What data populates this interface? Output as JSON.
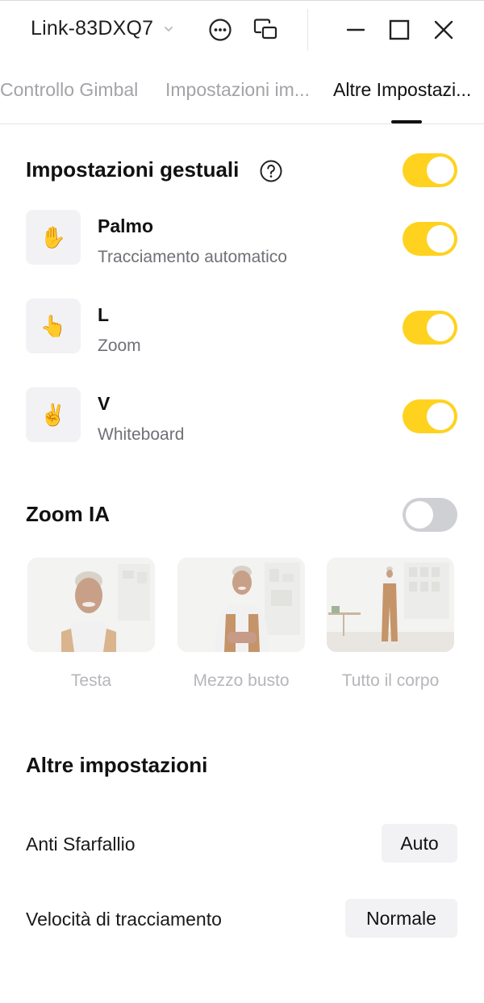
{
  "titlebar": {
    "device_name": "Link-83DXQ7",
    "icons": [
      "chevron-down-icon",
      "more-icon",
      "window-mode-icon",
      "minimize-icon",
      "maximize-icon",
      "close-icon"
    ]
  },
  "tabs": [
    {
      "label": "Controllo Gimbal",
      "active": false
    },
    {
      "label": "Impostazioni im...",
      "active": false
    },
    {
      "label": "Altre Impostazi...",
      "active": true
    }
  ],
  "gesture_settings": {
    "title": "Impostazioni gestuali",
    "enabled": true,
    "items": [
      {
        "icon": "✋",
        "icon_name": "palm-hand-icon",
        "title": "Palmo",
        "subtitle": "Tracciamento automatico",
        "enabled": true
      },
      {
        "icon": "👆",
        "icon_name": "pointing-finger-icon",
        "title": "L",
        "subtitle": "Zoom",
        "enabled": true
      },
      {
        "icon": "✌️",
        "icon_name": "victory-hand-icon",
        "title": "V",
        "subtitle": "Whiteboard",
        "enabled": true
      }
    ]
  },
  "zoom_ai": {
    "title": "Zoom IA",
    "enabled": false,
    "options": [
      {
        "label": "Testa"
      },
      {
        "label": "Mezzo busto"
      },
      {
        "label": "Tutto il corpo"
      }
    ]
  },
  "other_settings": {
    "title": "Altre impostazioni",
    "anti_flicker": {
      "label": "Anti Sfarfallio",
      "value": "Auto"
    },
    "tracking_speed": {
      "label": "Velocità di tracciamento",
      "value": "Normale"
    }
  },
  "colors": {
    "accent": "#ffd21f",
    "toggle_off": "#cfd0d4",
    "muted_text": "#707077"
  }
}
